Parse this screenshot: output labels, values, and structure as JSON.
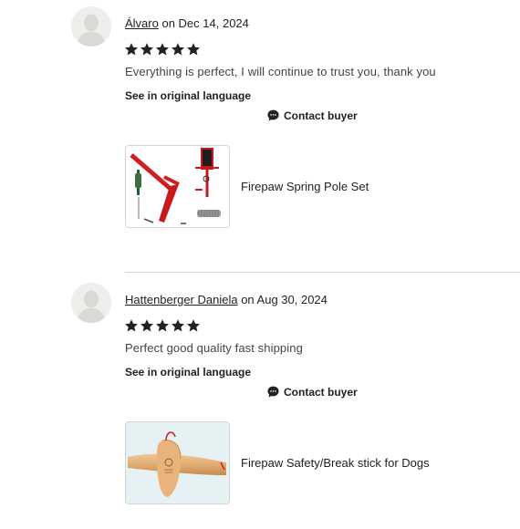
{
  "reviews": [
    {
      "reviewer": "Álvaro",
      "date_prefix": " on ",
      "date": "Dec 14, 2024",
      "rating": 5,
      "text": "Everything is perfect, I will continue to trust you, thank you",
      "see_original": "See in original language",
      "contact": "Contact buyer",
      "product_title": "Firepaw Spring Pole Set",
      "product_image_icon": "spring-pole-set-image"
    },
    {
      "reviewer": "Hattenberger Daniela",
      "date_prefix": " on ",
      "date": "Aug 30, 2024",
      "rating": 5,
      "text": "Perfect good quality fast shipping",
      "see_original": "See in original language",
      "contact": "Contact buyer",
      "product_title": "Firepaw Safety/Break stick for Dogs",
      "product_image_icon": "break-stick-image"
    }
  ],
  "colors": {
    "text": "#222222",
    "muted_text": "#444444",
    "divider": "#d6d6d6",
    "star": "#222222",
    "avatar_bg": "#eeeeec",
    "spring_pole_red": "#d01f1f"
  }
}
